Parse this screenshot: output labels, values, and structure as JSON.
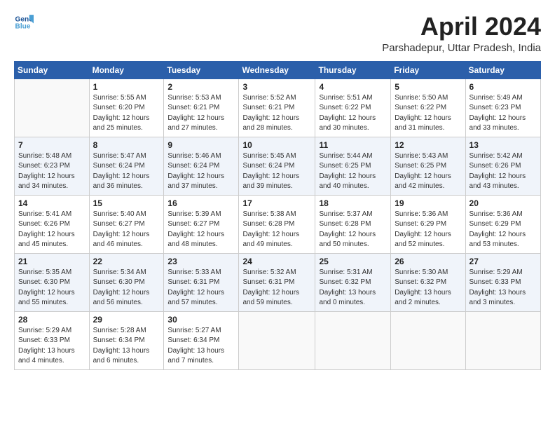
{
  "header": {
    "logo_line1": "General",
    "logo_line2": "Blue",
    "month_title": "April 2024",
    "location": "Parshadepur, Uttar Pradesh, India"
  },
  "calendar": {
    "days_of_week": [
      "Sunday",
      "Monday",
      "Tuesday",
      "Wednesday",
      "Thursday",
      "Friday",
      "Saturday"
    ],
    "weeks": [
      [
        {
          "day": "",
          "info": ""
        },
        {
          "day": "1",
          "info": "Sunrise: 5:55 AM\nSunset: 6:20 PM\nDaylight: 12 hours\nand 25 minutes."
        },
        {
          "day": "2",
          "info": "Sunrise: 5:53 AM\nSunset: 6:21 PM\nDaylight: 12 hours\nand 27 minutes."
        },
        {
          "day": "3",
          "info": "Sunrise: 5:52 AM\nSunset: 6:21 PM\nDaylight: 12 hours\nand 28 minutes."
        },
        {
          "day": "4",
          "info": "Sunrise: 5:51 AM\nSunset: 6:22 PM\nDaylight: 12 hours\nand 30 minutes."
        },
        {
          "day": "5",
          "info": "Sunrise: 5:50 AM\nSunset: 6:22 PM\nDaylight: 12 hours\nand 31 minutes."
        },
        {
          "day": "6",
          "info": "Sunrise: 5:49 AM\nSunset: 6:23 PM\nDaylight: 12 hours\nand 33 minutes."
        }
      ],
      [
        {
          "day": "7",
          "info": "Sunrise: 5:48 AM\nSunset: 6:23 PM\nDaylight: 12 hours\nand 34 minutes."
        },
        {
          "day": "8",
          "info": "Sunrise: 5:47 AM\nSunset: 6:24 PM\nDaylight: 12 hours\nand 36 minutes."
        },
        {
          "day": "9",
          "info": "Sunrise: 5:46 AM\nSunset: 6:24 PM\nDaylight: 12 hours\nand 37 minutes."
        },
        {
          "day": "10",
          "info": "Sunrise: 5:45 AM\nSunset: 6:24 PM\nDaylight: 12 hours\nand 39 minutes."
        },
        {
          "day": "11",
          "info": "Sunrise: 5:44 AM\nSunset: 6:25 PM\nDaylight: 12 hours\nand 40 minutes."
        },
        {
          "day": "12",
          "info": "Sunrise: 5:43 AM\nSunset: 6:25 PM\nDaylight: 12 hours\nand 42 minutes."
        },
        {
          "day": "13",
          "info": "Sunrise: 5:42 AM\nSunset: 6:26 PM\nDaylight: 12 hours\nand 43 minutes."
        }
      ],
      [
        {
          "day": "14",
          "info": "Sunrise: 5:41 AM\nSunset: 6:26 PM\nDaylight: 12 hours\nand 45 minutes."
        },
        {
          "day": "15",
          "info": "Sunrise: 5:40 AM\nSunset: 6:27 PM\nDaylight: 12 hours\nand 46 minutes."
        },
        {
          "day": "16",
          "info": "Sunrise: 5:39 AM\nSunset: 6:27 PM\nDaylight: 12 hours\nand 48 minutes."
        },
        {
          "day": "17",
          "info": "Sunrise: 5:38 AM\nSunset: 6:28 PM\nDaylight: 12 hours\nand 49 minutes."
        },
        {
          "day": "18",
          "info": "Sunrise: 5:37 AM\nSunset: 6:28 PM\nDaylight: 12 hours\nand 50 minutes."
        },
        {
          "day": "19",
          "info": "Sunrise: 5:36 AM\nSunset: 6:29 PM\nDaylight: 12 hours\nand 52 minutes."
        },
        {
          "day": "20",
          "info": "Sunrise: 5:36 AM\nSunset: 6:29 PM\nDaylight: 12 hours\nand 53 minutes."
        }
      ],
      [
        {
          "day": "21",
          "info": "Sunrise: 5:35 AM\nSunset: 6:30 PM\nDaylight: 12 hours\nand 55 minutes."
        },
        {
          "day": "22",
          "info": "Sunrise: 5:34 AM\nSunset: 6:30 PM\nDaylight: 12 hours\nand 56 minutes."
        },
        {
          "day": "23",
          "info": "Sunrise: 5:33 AM\nSunset: 6:31 PM\nDaylight: 12 hours\nand 57 minutes."
        },
        {
          "day": "24",
          "info": "Sunrise: 5:32 AM\nSunset: 6:31 PM\nDaylight: 12 hours\nand 59 minutes."
        },
        {
          "day": "25",
          "info": "Sunrise: 5:31 AM\nSunset: 6:32 PM\nDaylight: 13 hours\nand 0 minutes."
        },
        {
          "day": "26",
          "info": "Sunrise: 5:30 AM\nSunset: 6:32 PM\nDaylight: 13 hours\nand 2 minutes."
        },
        {
          "day": "27",
          "info": "Sunrise: 5:29 AM\nSunset: 6:33 PM\nDaylight: 13 hours\nand 3 minutes."
        }
      ],
      [
        {
          "day": "28",
          "info": "Sunrise: 5:29 AM\nSunset: 6:33 PM\nDaylight: 13 hours\nand 4 minutes."
        },
        {
          "day": "29",
          "info": "Sunrise: 5:28 AM\nSunset: 6:34 PM\nDaylight: 13 hours\nand 6 minutes."
        },
        {
          "day": "30",
          "info": "Sunrise: 5:27 AM\nSunset: 6:34 PM\nDaylight: 13 hours\nand 7 minutes."
        },
        {
          "day": "",
          "info": ""
        },
        {
          "day": "",
          "info": ""
        },
        {
          "day": "",
          "info": ""
        },
        {
          "day": "",
          "info": ""
        }
      ]
    ]
  }
}
